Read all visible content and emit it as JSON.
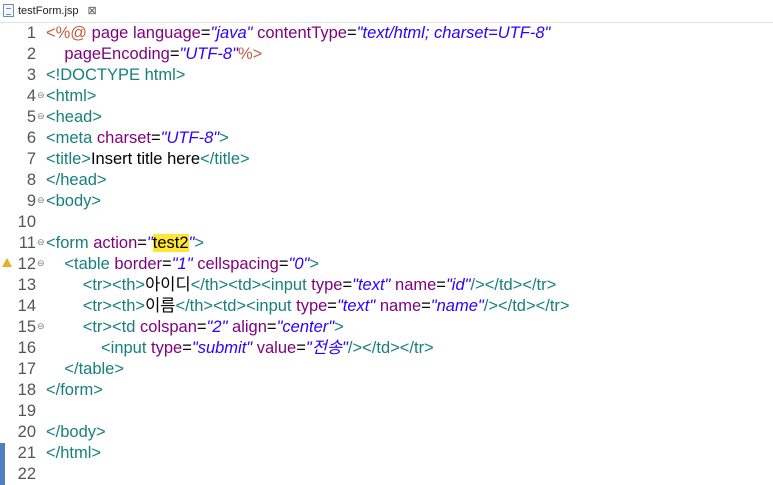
{
  "colors": {
    "tag": "#17807e",
    "attribute": "#7f007f",
    "string": "#2a00ff",
    "directive": "#bf5f3f",
    "text": "#000000",
    "highlight": "#ffe534",
    "change_marker": "#4f7ec2",
    "warning": "#e8b020"
  },
  "tab": {
    "title": "testForm.jsp",
    "icon": "jsp-file-icon",
    "close_glyph": "⊠"
  },
  "lines": [
    {
      "num": "1",
      "fold": false,
      "warning": false,
      "marker": false,
      "tokens": [
        {
          "t": "dir",
          "v": "<%@ "
        },
        {
          "t": "attr",
          "v": "page language"
        },
        {
          "t": "text",
          "v": "="
        },
        {
          "t": "str",
          "v": "\"java\""
        },
        {
          "t": "text",
          "v": " "
        },
        {
          "t": "attr",
          "v": "contentType"
        },
        {
          "t": "text",
          "v": "="
        },
        {
          "t": "str",
          "v": "\"text/html; charset=UTF-8\""
        }
      ]
    },
    {
      "num": "2",
      "fold": false,
      "warning": false,
      "marker": false,
      "tokens": [
        {
          "t": "text",
          "v": "    "
        },
        {
          "t": "attr",
          "v": "pageEncoding"
        },
        {
          "t": "text",
          "v": "="
        },
        {
          "t": "str",
          "v": "\"UTF-8\""
        },
        {
          "t": "dir",
          "v": "%>"
        }
      ]
    },
    {
      "num": "3",
      "fold": false,
      "warning": false,
      "marker": false,
      "tokens": [
        {
          "t": "tag",
          "v": "<!DOCTYPE html>"
        }
      ]
    },
    {
      "num": "4",
      "fold": true,
      "warning": false,
      "marker": false,
      "tokens": [
        {
          "t": "tag",
          "v": "<html>"
        }
      ]
    },
    {
      "num": "5",
      "fold": true,
      "warning": false,
      "marker": false,
      "tokens": [
        {
          "t": "tag",
          "v": "<head>"
        }
      ]
    },
    {
      "num": "6",
      "fold": false,
      "warning": false,
      "marker": false,
      "tokens": [
        {
          "t": "tag",
          "v": "<meta "
        },
        {
          "t": "attr",
          "v": "charset"
        },
        {
          "t": "text",
          "v": "="
        },
        {
          "t": "str",
          "v": "\"UTF-8\""
        },
        {
          "t": "tag",
          "v": ">"
        }
      ]
    },
    {
      "num": "7",
      "fold": false,
      "warning": false,
      "marker": false,
      "tokens": [
        {
          "t": "tag",
          "v": "<title>"
        },
        {
          "t": "text",
          "v": "Insert title here"
        },
        {
          "t": "tag",
          "v": "</title>"
        }
      ]
    },
    {
      "num": "8",
      "fold": false,
      "warning": false,
      "marker": false,
      "tokens": [
        {
          "t": "tag",
          "v": "</head>"
        }
      ]
    },
    {
      "num": "9",
      "fold": true,
      "warning": false,
      "marker": false,
      "tokens": [
        {
          "t": "tag",
          "v": "<body>"
        }
      ]
    },
    {
      "num": "10",
      "fold": false,
      "warning": false,
      "marker": false,
      "tokens": []
    },
    {
      "num": "11",
      "fold": true,
      "warning": false,
      "marker": false,
      "tokens": [
        {
          "t": "tag",
          "v": "<form "
        },
        {
          "t": "attr",
          "v": "action"
        },
        {
          "t": "text",
          "v": "="
        },
        {
          "t": "str",
          "v": "\""
        },
        {
          "t": "hl",
          "v": "test2"
        },
        {
          "t": "str",
          "v": "\""
        },
        {
          "t": "tag",
          "v": ">"
        }
      ]
    },
    {
      "num": "12",
      "fold": true,
      "warning": true,
      "marker": false,
      "tokens": [
        {
          "t": "text",
          "v": "    "
        },
        {
          "t": "tag",
          "v": "<table "
        },
        {
          "t": "attr",
          "v": "border"
        },
        {
          "t": "text",
          "v": "="
        },
        {
          "t": "str",
          "v": "\"1\""
        },
        {
          "t": "text",
          "v": " "
        },
        {
          "t": "attr",
          "v": "cellspacing"
        },
        {
          "t": "text",
          "v": "="
        },
        {
          "t": "str",
          "v": "\"0\""
        },
        {
          "t": "tag",
          "v": ">"
        }
      ]
    },
    {
      "num": "13",
      "fold": false,
      "warning": false,
      "marker": false,
      "tokens": [
        {
          "t": "text",
          "v": "        "
        },
        {
          "t": "tag",
          "v": "<tr><th>"
        },
        {
          "t": "text",
          "v": "아이디"
        },
        {
          "t": "tag",
          "v": "</th><td><input "
        },
        {
          "t": "attr",
          "v": "type"
        },
        {
          "t": "text",
          "v": "="
        },
        {
          "t": "str",
          "v": "\"text\""
        },
        {
          "t": "text",
          "v": " "
        },
        {
          "t": "attr",
          "v": "name"
        },
        {
          "t": "text",
          "v": "="
        },
        {
          "t": "str",
          "v": "\"id\""
        },
        {
          "t": "tag",
          "v": "/></td></tr>"
        }
      ]
    },
    {
      "num": "14",
      "fold": false,
      "warning": false,
      "marker": false,
      "tokens": [
        {
          "t": "text",
          "v": "        "
        },
        {
          "t": "tag",
          "v": "<tr><th>"
        },
        {
          "t": "text",
          "v": "이름"
        },
        {
          "t": "tag",
          "v": "</th><td><input "
        },
        {
          "t": "attr",
          "v": "type"
        },
        {
          "t": "text",
          "v": "="
        },
        {
          "t": "str",
          "v": "\"text\""
        },
        {
          "t": "text",
          "v": " "
        },
        {
          "t": "attr",
          "v": "name"
        },
        {
          "t": "text",
          "v": "="
        },
        {
          "t": "str",
          "v": "\"name\""
        },
        {
          "t": "tag",
          "v": "/></td></tr>"
        }
      ]
    },
    {
      "num": "15",
      "fold": true,
      "warning": false,
      "marker": false,
      "tokens": [
        {
          "t": "text",
          "v": "        "
        },
        {
          "t": "tag",
          "v": "<tr><td "
        },
        {
          "t": "attr",
          "v": "colspan"
        },
        {
          "t": "text",
          "v": "="
        },
        {
          "t": "str",
          "v": "\"2\""
        },
        {
          "t": "text",
          "v": " "
        },
        {
          "t": "attr",
          "v": "align"
        },
        {
          "t": "text",
          "v": "="
        },
        {
          "t": "str",
          "v": "\"center\""
        },
        {
          "t": "tag",
          "v": ">"
        }
      ]
    },
    {
      "num": "16",
      "fold": false,
      "warning": false,
      "marker": false,
      "tokens": [
        {
          "t": "text",
          "v": "            "
        },
        {
          "t": "tag",
          "v": "<input "
        },
        {
          "t": "attr",
          "v": "type"
        },
        {
          "t": "text",
          "v": "="
        },
        {
          "t": "str",
          "v": "\"submit\""
        },
        {
          "t": "text",
          "v": " "
        },
        {
          "t": "attr",
          "v": "value"
        },
        {
          "t": "text",
          "v": "="
        },
        {
          "t": "str",
          "v": "\"전송\""
        },
        {
          "t": "tag",
          "v": "/></td></tr>"
        }
      ]
    },
    {
      "num": "17",
      "fold": false,
      "warning": false,
      "marker": false,
      "tokens": [
        {
          "t": "text",
          "v": "    "
        },
        {
          "t": "tag",
          "v": "</table>"
        }
      ]
    },
    {
      "num": "18",
      "fold": false,
      "warning": false,
      "marker": false,
      "tokens": [
        {
          "t": "tag",
          "v": "</form>"
        }
      ]
    },
    {
      "num": "19",
      "fold": false,
      "warning": false,
      "marker": false,
      "tokens": []
    },
    {
      "num": "20",
      "fold": false,
      "warning": false,
      "marker": false,
      "tokens": [
        {
          "t": "tag",
          "v": "</body>"
        }
      ]
    },
    {
      "num": "21",
      "fold": false,
      "warning": false,
      "marker": true,
      "tokens": [
        {
          "t": "tag",
          "v": "</html>"
        }
      ]
    },
    {
      "num": "22",
      "fold": false,
      "warning": false,
      "marker": true,
      "tokens": []
    }
  ]
}
